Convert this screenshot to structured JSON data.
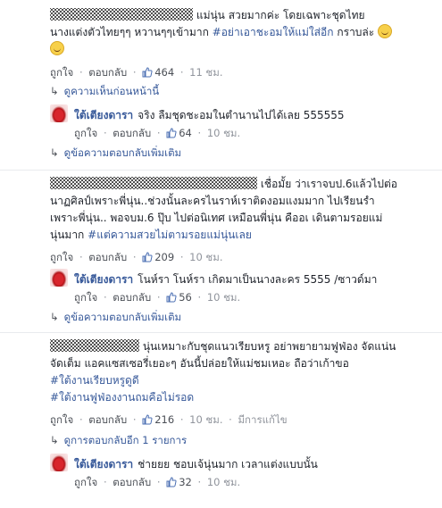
{
  "colors": {
    "link": "#365899",
    "meta": "#90949c",
    "action": "#4b4f56"
  },
  "icons": {
    "like": "thumbs-up-icon",
    "reply_arrow": "reply-arrow-icon",
    "emoji": "grinning-emoji-icon"
  },
  "comments": [
    {
      "text_line1": "แม่นุ่น สวยมากค่ะ โดยเฉพาะชุดไทย",
      "text_line2": "นางแต่งตัวไทยๆๆ หวานๆๆเข้ามาก",
      "hashtag": "#อย่าเอาชะอมให้แม่ใส่อีก",
      "text_tail": "กราบล่ะ",
      "like_label": "ถูกใจ",
      "reply_label": "ตอบกลับ",
      "likes": "464",
      "time": "11 ชม.",
      "previous_label": "ดูความเห็นก่อนหน้านี้",
      "reply": {
        "author": "ใต้เตียงดารา",
        "text": "จริง ลืมชุดชะอมในตำนานไปได้เลย 555555",
        "like_label": "ถูกใจ",
        "reply_label": "ตอบกลับ",
        "likes": "64",
        "time": "10 ชม."
      },
      "more_label": "ดูข้อความตอบกลับเพิ่มเติม"
    },
    {
      "text_line1": "เชื่อมั้ย ว่าเราจบป.6แล้วไปต่อ",
      "text_line2": "นาฏศิลป์เพราะพี่นุ่น..ช่วงนั้นละครไนราห์เราติดงอมแงมมาก ไปเรียนรำ",
      "text_line3": "เพราะพี่นุ่น.. พอจบม.6 ปุ๊บ ไปต่อนิเทศ เหมือนพี่นุ่น คืออเ เดินตามรอยแม่",
      "text_line4": "นุ่นมาก",
      "hashtag": "#แต่ความสวยไม่ตามรอยแม่นุ่นเลย",
      "like_label": "ถูกใจ",
      "reply_label": "ตอบกลับ",
      "likes": "209",
      "time": "10 ชม.",
      "reply": {
        "author": "ใต้เตียงดารา",
        "text": "โนห์รา โนห์รา เกิดมาเป็นนางละคร 5555 /ซาวด์มา",
        "like_label": "ถูกใจ",
        "reply_label": "ตอบกลับ",
        "likes": "56",
        "time": "10 ชม."
      },
      "more_label": "ดูข้อความตอบกลับเพิ่มเติม"
    },
    {
      "text_line1": "นุ่นเหมาะกับชุดแนวเรียบหรู อย่าพยายามฟูฟ่อง จัดแน่น",
      "text_line2": "จัดเต็ม แอคแซสเซอรี่เยอะๆ อันนี้ปล่อยให้แม่ชมเหอะ ถือว่าเก้าขอ",
      "hashtag1": "#ใต้งานเรียบหรูดูดี",
      "hashtag2": "#ใต้งานฟูฟ่องงานถมคือไม่รอด",
      "like_label": "ถูกใจ",
      "reply_label": "ตอบกลับ",
      "likes": "216",
      "time": "10 ชม.",
      "edited_label": "มีการแก้ไข",
      "view_replies_label": "ดูการตอบกลับอีก 1 รายการ",
      "reply": {
        "author": "ใต้เตียงดารา",
        "text": "ช่ายยย ชอบเจ้นุ่นมาก เวลาแต่งแบบนั้น",
        "like_label": "ถูกใจ",
        "reply_label": "ตอบกลับ",
        "likes": "32",
        "time": "10 ชม."
      }
    }
  ]
}
